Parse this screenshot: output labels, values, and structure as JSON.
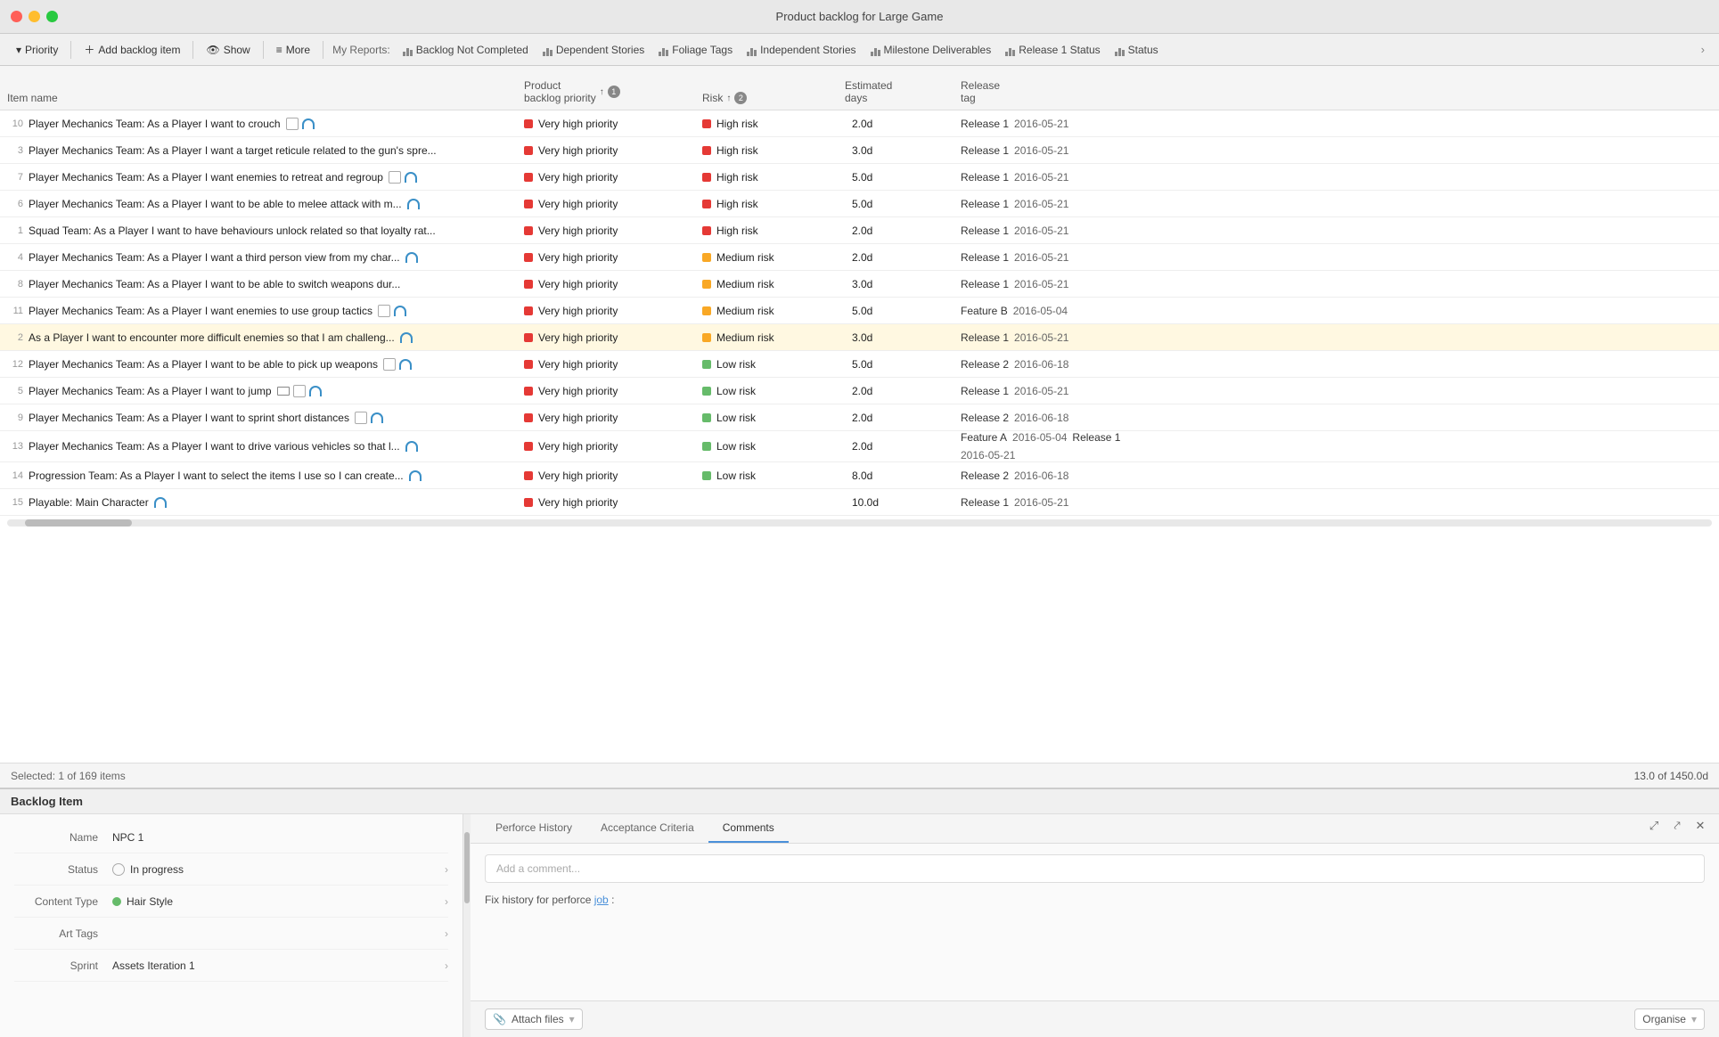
{
  "app": {
    "title": "Product backlog for Large Game"
  },
  "toolbar": {
    "priority_label": "Priority",
    "add_backlog_label": "Add backlog item",
    "show_label": "Show",
    "more_label": "More",
    "my_reports_label": "My Reports:",
    "reports": [
      {
        "id": "backlog-not-completed",
        "label": "Backlog Not Completed"
      },
      {
        "id": "dependent-stories",
        "label": "Dependent Stories"
      },
      {
        "id": "foliage-tags",
        "label": "Foliage Tags"
      },
      {
        "id": "independent-stories",
        "label": "Independent Stories"
      },
      {
        "id": "milestone-deliverables",
        "label": "Milestone Deliverables"
      },
      {
        "id": "release-1-status",
        "label": "Release 1 Status"
      },
      {
        "id": "status",
        "label": "Status"
      }
    ]
  },
  "table": {
    "columns": [
      {
        "id": "item-name",
        "label": "Item name"
      },
      {
        "id": "product-backlog-priority",
        "label": "Product backlog priority",
        "sort": "↑",
        "sort_num": "1"
      },
      {
        "id": "risk",
        "label": "Risk",
        "sort": "↑",
        "sort_num": "2"
      },
      {
        "id": "estimated-days",
        "label": "Estimated days"
      },
      {
        "id": "release-tag",
        "label": "Release tag"
      }
    ],
    "rows": [
      {
        "num": "10",
        "name": "Player Mechanics Team: As a Player I want to crouch",
        "team": "Player Mechanics Team",
        "desc": "As a Player I want to crouch",
        "icons": [
          "checkbox",
          "headphone"
        ],
        "priority": "Very high priority",
        "priority_color": "red",
        "risk": "High risk",
        "risk_color": "red",
        "days": "2.0d",
        "release": "Release 1",
        "release_date": "2016-05-21",
        "release2": "",
        "release2_date": ""
      },
      {
        "num": "3",
        "name": "Player Mechanics Team: As a Player I want a target reticule related to the gun's spre...",
        "team": "Player Mechanics Team",
        "desc": "As a Player I want a target reticule related to the gun's spre...",
        "icons": [],
        "priority": "Very high priority",
        "priority_color": "red",
        "risk": "High risk",
        "risk_color": "red",
        "days": "3.0d",
        "release": "Release 1",
        "release_date": "2016-05-21",
        "release2": "",
        "release2_date": ""
      },
      {
        "num": "7",
        "name": "Player Mechanics Team: As a Player I want enemies to retreat and regroup",
        "team": "Player Mechanics Team",
        "desc": "As a Player I want enemies to retreat and regroup",
        "icons": [
          "checkbox",
          "headphone"
        ],
        "priority": "Very high priority",
        "priority_color": "red",
        "risk": "High risk",
        "risk_color": "red",
        "days": "5.0d",
        "release": "Release 1",
        "release_date": "2016-05-21",
        "release2": "",
        "release2_date": ""
      },
      {
        "num": "6",
        "name": "Player Mechanics Team: As a Player I want to be able to melee attack with m...",
        "team": "Player Mechanics Team",
        "desc": "As a Player I want to be able to melee attack with m...",
        "icons": [
          "headphone"
        ],
        "priority": "Very high priority",
        "priority_color": "red",
        "risk": "High risk",
        "risk_color": "red",
        "days": "5.0d",
        "release": "Release 1",
        "release_date": "2016-05-21",
        "release2": "",
        "release2_date": ""
      },
      {
        "num": "1",
        "name": "Squad Team: As a Player I want to have behaviours unlock related so that loyalty rat...",
        "team": "Squad Team",
        "desc": "As a Player I want to have behaviours unlock related so that loyalty rat...",
        "icons": [],
        "priority": "Very high priority",
        "priority_color": "red",
        "risk": "High risk",
        "risk_color": "red",
        "days": "2.0d",
        "release": "Release 1",
        "release_date": "2016-05-21",
        "release2": "",
        "release2_date": ""
      },
      {
        "num": "4",
        "name": "Player Mechanics Team: As a Player I want a third person view from my char...",
        "team": "Player Mechanics Team",
        "desc": "As a Player I want a third person view from my char...",
        "icons": [
          "headphone"
        ],
        "priority": "Very high priority",
        "priority_color": "red",
        "risk": "Medium risk",
        "risk_color": "yellow",
        "days": "2.0d",
        "release": "Release 1",
        "release_date": "2016-05-21",
        "release2": "",
        "release2_date": ""
      },
      {
        "num": "8",
        "name": "Player Mechanics Team: As a Player I want to be able to switch weapons dur...",
        "team": "Player Mechanics Team",
        "desc": "As a Player I want to be able to switch weapons dur...",
        "icons": [],
        "priority": "Very high priority",
        "priority_color": "red",
        "risk": "Medium risk",
        "risk_color": "yellow",
        "days": "3.0d",
        "release": "Release 1",
        "release_date": "2016-05-21",
        "release2": "",
        "release2_date": ""
      },
      {
        "num": "11",
        "name": "Player Mechanics Team: As a Player I want enemies to use group tactics",
        "team": "Player Mechanics Team",
        "desc": "As a Player I want enemies to use group tactics",
        "icons": [
          "checkbox",
          "headphone"
        ],
        "priority": "Very high priority",
        "priority_color": "red",
        "risk": "Medium risk",
        "risk_color": "yellow",
        "days": "5.0d",
        "release": "Feature B",
        "release_date": "2016-05-04",
        "release2": "",
        "release2_date": ""
      },
      {
        "num": "2",
        "name": "As a Player I want to encounter more difficult enemies so that I am challeng...",
        "team": "",
        "desc": "As a Player I want to encounter more difficult enemies so that I am challeng...",
        "icons": [
          "headphone"
        ],
        "priority": "Very high priority",
        "priority_color": "red",
        "risk": "Medium risk",
        "risk_color": "yellow",
        "days": "3.0d",
        "release": "Release 1",
        "release_date": "2016-05-21",
        "release2": "",
        "release2_date": "",
        "highlighted": true
      },
      {
        "num": "12",
        "name": "Player Mechanics Team: As a Player I want to be able to pick up weapons",
        "team": "Player Mechanics Team",
        "desc": "As a Player I want to be able to pick up weapons",
        "icons": [
          "checkbox",
          "headphone"
        ],
        "priority": "Very high priority",
        "priority_color": "red",
        "risk": "Low risk",
        "risk_color": "green",
        "days": "5.0d",
        "release": "Release 2",
        "release_date": "2016-06-18",
        "release2": "",
        "release2_date": ""
      },
      {
        "num": "5",
        "name": "Player Mechanics Team: As a Player I want to jump",
        "team": "Player Mechanics Team",
        "desc": "As a Player I want to jump",
        "icons": [
          "envelope",
          "checkbox",
          "headphone"
        ],
        "priority": "Very high priority",
        "priority_color": "red",
        "risk": "Low risk",
        "risk_color": "green",
        "days": "2.0d",
        "release": "Release 1",
        "release_date": "2016-05-21",
        "release2": "",
        "release2_date": ""
      },
      {
        "num": "9",
        "name": "Player Mechanics Team: As a Player I want to sprint short distances",
        "team": "Player Mechanics Team",
        "desc": "As a Player I want to sprint short distances",
        "icons": [
          "checkbox",
          "headphone"
        ],
        "priority": "Very high priority",
        "priority_color": "red",
        "risk": "Low risk",
        "risk_color": "green",
        "days": "2.0d",
        "release": "Release 2",
        "release_date": "2016-06-18",
        "release2": "",
        "release2_date": ""
      },
      {
        "num": "13",
        "name": "Player Mechanics Team: As a Player I want to drive various vehicles so that l...",
        "team": "Player Mechanics Team",
        "desc": "As a Player I want to drive various vehicles so that l...",
        "icons": [
          "headphone"
        ],
        "priority": "Very high priority",
        "priority_color": "red",
        "risk": "Low risk",
        "risk_color": "green",
        "days": "2.0d",
        "release": "Feature A",
        "release_date": "2016-05-04",
        "release2": "Release 1",
        "release2_date": "2016-05-21"
      },
      {
        "num": "14",
        "name": "Progression Team: As a Player I want to select the items I use so I can create...",
        "team": "Progression Team",
        "desc": "As a Player I want to select the items I use so I can create...",
        "icons": [
          "headphone"
        ],
        "priority": "Very high priority",
        "priority_color": "red",
        "risk": "Low risk",
        "risk_color": "green",
        "days": "8.0d",
        "release": "Release 2",
        "release_date": "2016-06-18",
        "release2": "",
        "release2_date": ""
      },
      {
        "num": "15",
        "name": "Playable: Main Character",
        "team": "Playable",
        "desc": "Main Character",
        "icons": [
          "headphone"
        ],
        "priority": "Very high priority",
        "priority_color": "red",
        "risk": "",
        "risk_color": "",
        "days": "10.0d",
        "release": "Release 1",
        "release_date": "2016-05-21",
        "release2": "",
        "release2_date": ""
      }
    ]
  },
  "status_bar": {
    "selected_text": "Selected: 1 of 169 items",
    "summary_text": "13.0 of 1450.0d"
  },
  "bottom_panel": {
    "header": "Backlog Item",
    "fields": [
      {
        "label": "Name",
        "value": "NPC 1",
        "has_icon": false,
        "has_chevron": false
      },
      {
        "label": "Status",
        "value": "In progress",
        "icon_type": "circle",
        "has_chevron": true
      },
      {
        "label": "Content Type",
        "value": "Hair Style",
        "icon_type": "green-dot",
        "has_chevron": true
      },
      {
        "label": "Art Tags",
        "value": "",
        "has_chevron": true
      },
      {
        "label": "Sprint",
        "value": "Assets Iteration 1",
        "has_chevron": true
      }
    ],
    "tabs": [
      {
        "id": "perforce-history",
        "label": "Perforce History",
        "active": false
      },
      {
        "id": "acceptance-criteria",
        "label": "Acceptance Criteria",
        "active": false
      },
      {
        "id": "comments",
        "label": "Comments",
        "active": true
      }
    ],
    "comments_placeholder": "Add a comment...",
    "perforce_text": "Fix history for perforce",
    "perforce_link": "job",
    "perforce_suffix": ":",
    "footer": {
      "attach_label": "Attach files",
      "organise_label": "Organise"
    }
  },
  "colors": {
    "accent_blue": "#4a90d9",
    "red_priority": "#e53935",
    "yellow_risk": "#f9a825",
    "green_risk": "#66bb6a"
  }
}
